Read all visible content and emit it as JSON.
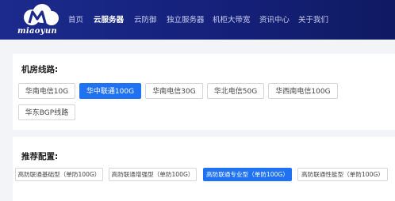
{
  "brand": {
    "name": "miaoyun"
  },
  "nav": {
    "items": [
      {
        "label": "首页",
        "active": false
      },
      {
        "label": "云服务器",
        "active": true
      },
      {
        "label": "云防御",
        "active": false
      },
      {
        "label": "独立服务器",
        "active": false
      },
      {
        "label": "机柜大带宽",
        "active": false
      },
      {
        "label": "资讯中心",
        "active": false
      },
      {
        "label": "关于我们",
        "active": false
      }
    ]
  },
  "routes": {
    "title": "机房线路:",
    "options": [
      {
        "label": "华南电信10G",
        "active": false
      },
      {
        "label": "华中联通100G",
        "active": true
      },
      {
        "label": "华南电信30G",
        "active": false
      },
      {
        "label": "华北电信50G",
        "active": false
      },
      {
        "label": "华西南电信100G",
        "active": false
      },
      {
        "label": "华东BGP线路",
        "active": false
      }
    ]
  },
  "configs": {
    "title": "推荐配置:",
    "options": [
      {
        "label": "高防联通基础型（单防100G）",
        "active": false
      },
      {
        "label": "高防联通增强型（单防100G）",
        "active": false
      },
      {
        "label": "高防联通专业型（单防100G）",
        "active": true
      },
      {
        "label": "高防联通性能型（单防100G）",
        "active": false
      }
    ]
  },
  "colors": {
    "accent": "#1f73f2",
    "header_bg": "#15217a"
  }
}
